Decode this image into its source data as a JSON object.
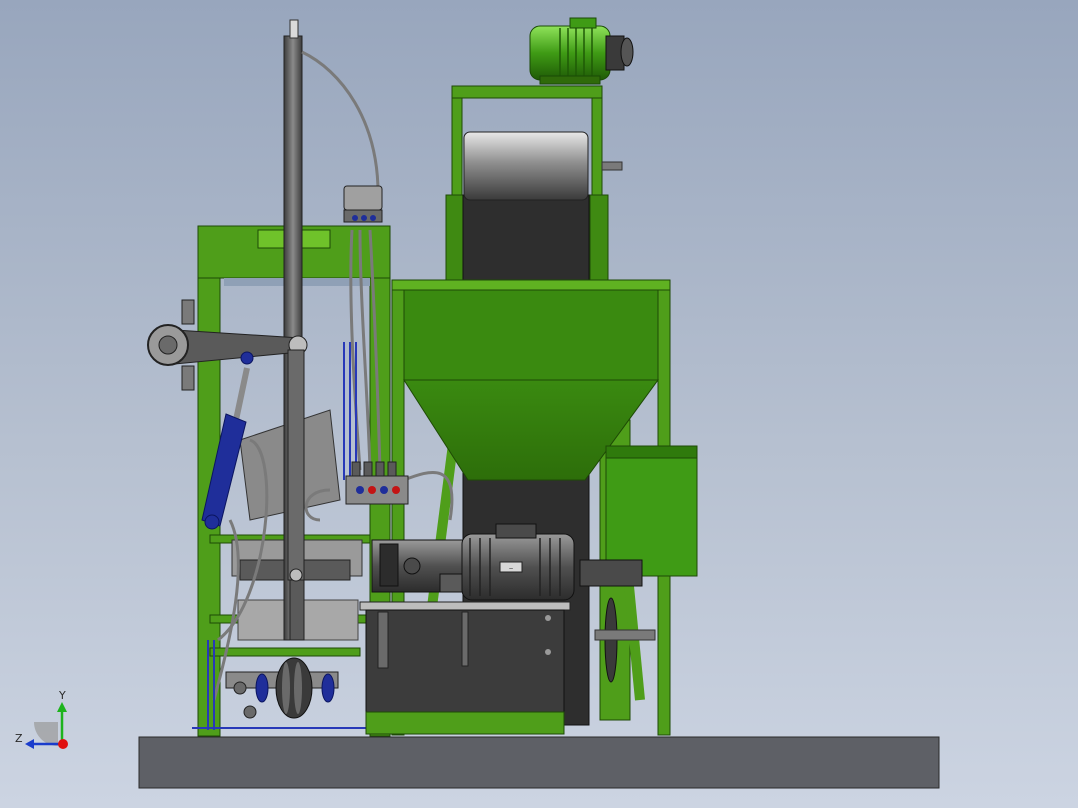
{
  "viewport": {
    "background_top": "#98a6bd",
    "background_bottom": "#ccd4e2"
  },
  "colors": {
    "frame_green": "#4f9e1a",
    "frame_green_dark": "#2f6a0a",
    "frame_green_light": "#6fc22a",
    "steel_dark": "#3e3e3e",
    "steel_mid": "#6a6a6a",
    "steel_light": "#b0b0b0",
    "hydraulic_blue": "#1f2e9a",
    "base_plate": "#5e6066"
  },
  "triad": {
    "y_label": "Y",
    "z_label": "Z",
    "y_axis_color": "#1db31d",
    "z_axis_color": "#1a3ccc",
    "origin_color": "#e01010"
  },
  "motor_nameplate": "—"
}
